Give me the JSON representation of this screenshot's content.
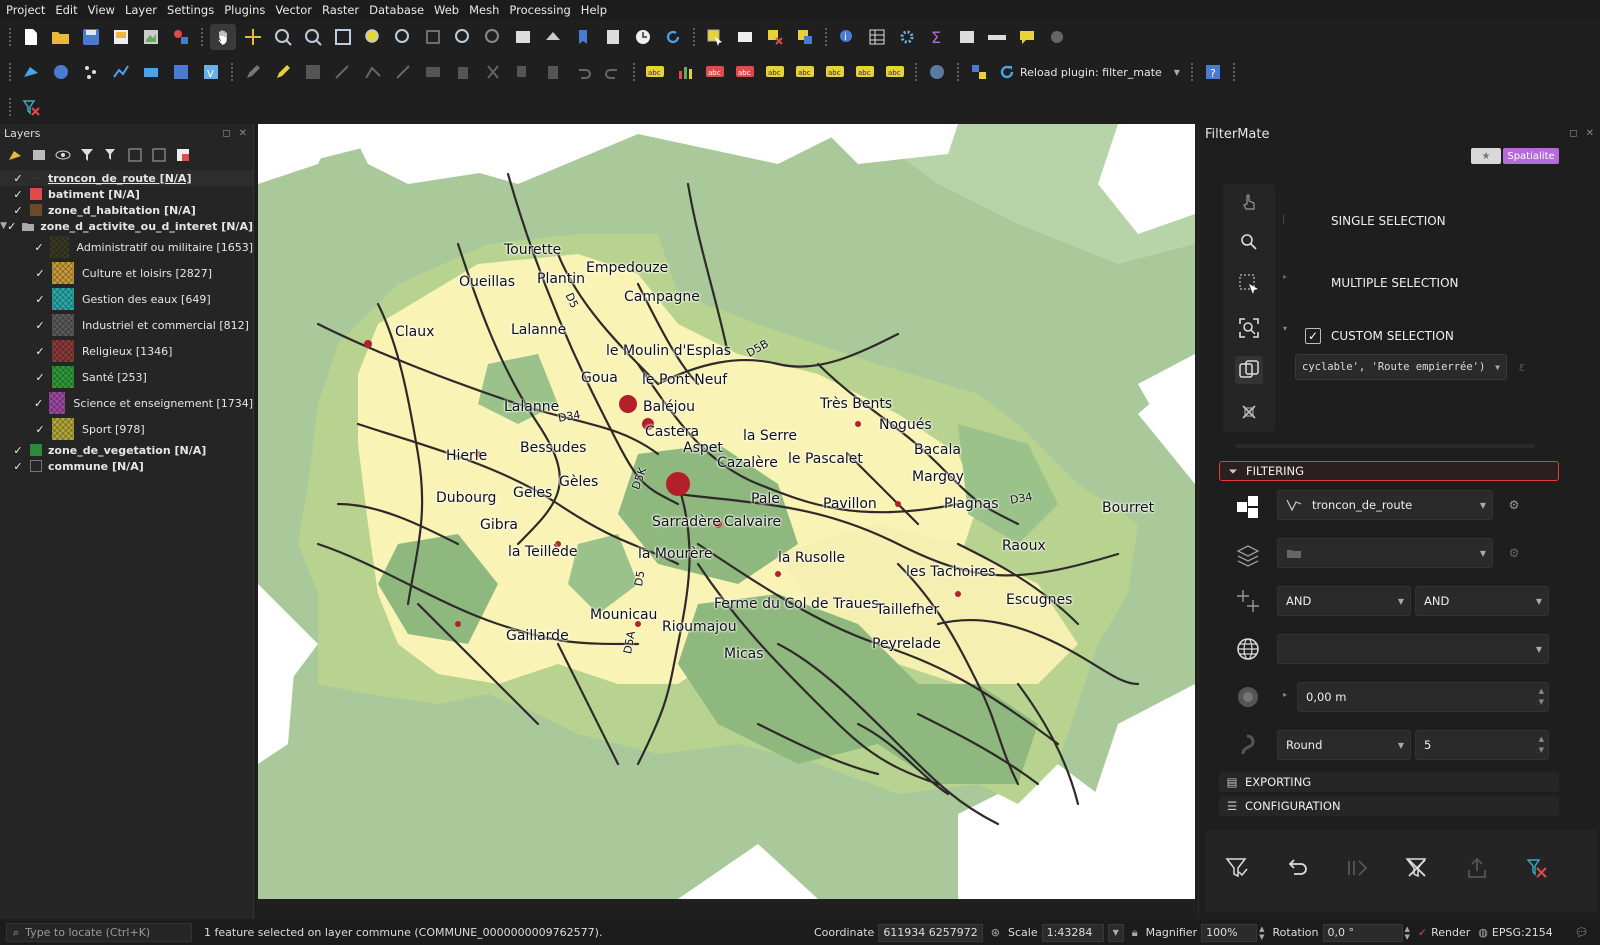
{
  "menu": [
    "Project",
    "Edit",
    "View",
    "Layer",
    "Settings",
    "Plugins",
    "Vector",
    "Raster",
    "Database",
    "Web",
    "Mesh",
    "Processing",
    "Help"
  ],
  "toolbar": {
    "reload_label": "Reload plugin: filter_mate"
  },
  "layers_panel": {
    "title": "Layers",
    "layers": [
      {
        "name": "troncon_de_route [N/A]",
        "color": "#333333",
        "symbol": "line",
        "style": "bold-ul"
      },
      {
        "name": "batiment [N/A]",
        "color": "#e04a4a",
        "symbol": "fill",
        "style": "bold"
      },
      {
        "name": "zone_d_habitation [N/A]",
        "color": "#6b4a2a",
        "symbol": "fill",
        "style": "bold"
      },
      {
        "name": "zone_d_activite_ou_d_interet [N/A]",
        "symbol": "group",
        "style": "bold"
      }
    ],
    "categories": [
      {
        "name": "Administratif ou militaire [1653]",
        "color": "#3a3a24"
      },
      {
        "name": "Culture et loisirs [2827]",
        "color": "#c79a3a"
      },
      {
        "name": "Gestion des eaux [649]",
        "color": "#2aa7a7"
      },
      {
        "name": "Industriel et commercial [812]",
        "color": "#5a5a5a"
      },
      {
        "name": "Religieux [1346]",
        "color": "#8a3a3a"
      },
      {
        "name": "Santé [253]",
        "color": "#2f9a3a"
      },
      {
        "name": "Science et enseignement [1734]",
        "color": "#9a4aa0"
      },
      {
        "name": "Sport [978]",
        "color": "#b0a63a"
      }
    ],
    "bottom_layers": [
      {
        "name": "zone_de_vegetation [N/A]",
        "color": "#2e8a3a"
      },
      {
        "name": "commune [N/A]",
        "color": "#1f1f1f"
      }
    ]
  },
  "map": {
    "places": [
      "Tourette",
      "Empedouze",
      "Oueillas",
      "Plantin",
      "Campagne",
      "Claux",
      "Lalanne",
      "le Moulin d'Esplas",
      "Goua",
      "le Pont Neuf",
      "Lalanne",
      "Baléjou",
      "Très Bents",
      "Nogués",
      "Castera",
      "la Serre",
      "Bacala",
      "Hierle",
      "Bessudes",
      "Aspet",
      "Cazalère",
      "le Pascalet",
      "Margoy",
      "Gèles",
      "Dubourg",
      "Geles",
      "Pale",
      "Pavillon",
      "Plagnas",
      "Bourret",
      "Gibra",
      "Sarradère",
      "Calvaire",
      "la Teillède",
      "la Mourère",
      "la Rusolle",
      "Raoux",
      "les Tachoires",
      "Escugnes",
      "Ferme du Col de Traues",
      "Taillefher",
      "Mounicau",
      "Rioumajou",
      "Gaillarde",
      "Peyrelade",
      "Micas"
    ],
    "roads": [
      "D5",
      "D5B",
      "D34",
      "D5K",
      "D34",
      "D5",
      "D5A"
    ],
    "colors": {
      "bg": "#ffffff",
      "vegetation_light": "#a8c99a",
      "vegetation": "#8fb87e",
      "commune": "#b8d48f",
      "habitation": "#f9f3b8",
      "roads": "#2e2a2a",
      "buildings": "#b3202a"
    }
  },
  "filtermate": {
    "title": "FilterMate",
    "badge_star": "★",
    "badge_backend": "Spatialite",
    "single": "SINGLE SELECTION",
    "multiple": "MULTIPLE SELECTION",
    "custom": "CUSTOM SELECTION",
    "expression": "cyclable', 'Route empierrée')",
    "filtering": "FILTERING",
    "layer": "troncon_de_route",
    "op1": "AND",
    "op2": "AND",
    "buffer": "0,00 m",
    "cap": "Round",
    "segments": "5",
    "exporting": "EXPORTING",
    "configuration": "CONFIGURATION"
  },
  "status": {
    "locate_placeholder": "Type to locate (Ctrl+K)",
    "message": "1 feature selected on layer commune (COMMUNE_0000000009762577).",
    "coordinate_label": "Coordinate",
    "coordinate": "611934 6257972",
    "scale_label": "Scale",
    "scale": "1:43284",
    "magnifier_label": "Magnifier",
    "magnifier": "100%",
    "rotation_label": "Rotation",
    "rotation": "0,0 °",
    "render_label": "Render",
    "crs": "EPSG:2154"
  }
}
